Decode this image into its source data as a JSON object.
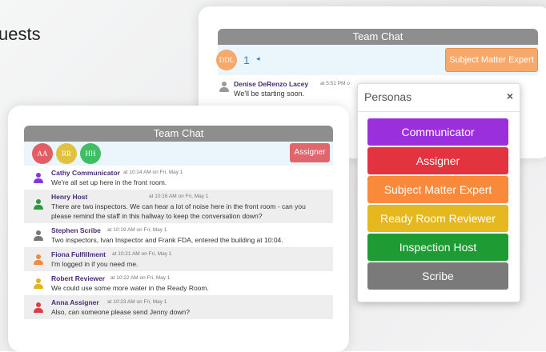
{
  "heading_fragment": "uests",
  "back_chat": {
    "title": "Team Chat",
    "avatar": "DDL",
    "count": "1",
    "arrow": "◂",
    "persona_button": "Subject Matter Expert",
    "message": {
      "name": "Denise DeRenzo Lacey",
      "time": "at 5:51 PM o",
      "text": "We'll be starting soon."
    }
  },
  "front_chat": {
    "title": "Team Chat",
    "avatars": [
      {
        "initials": "AA",
        "color": "#e35e64"
      },
      {
        "initials": "RR",
        "color": "#e0c23f"
      },
      {
        "initials": "HH",
        "color": "#3fbf63"
      }
    ],
    "persona_button": "Assigner",
    "messages": [
      {
        "name": "Cathy Communicator",
        "time": "at 10:14 AM on Fri, May 1",
        "text": "We're all set up here in the front room.",
        "icon_color": "#8a35d6"
      },
      {
        "name": "Henry Host",
        "time": "at 10:16 AM on Fri, May 1",
        "text": "There are two inspectors.  We can hear a lot of noise here in the front room - can you please remind the staff in this hallway to keep the conversation down?",
        "icon_color": "#2b9a3e"
      },
      {
        "name": "Stephen Scribe",
        "time": "at 10:19 AM on Fri, May 1",
        "text": "Two inspectors, Ivan Inspector and Frank FDA, entered the building at 10:04.",
        "icon_color": "#777777"
      },
      {
        "name": "Fiona Fulfillment",
        "time": "at 10:21 AM on Fri, May 1",
        "text": "I'm logged in if you need me.",
        "icon_color": "#f08a3c"
      },
      {
        "name": "Robert Reviewer",
        "time": "at 10:22 AM on Fri, May 1",
        "text": "We could use some more water in the Ready Room.",
        "icon_color": "#e3b320"
      },
      {
        "name": "Anna Assigner",
        "time": "at 10:23 AM on Fri, May 1",
        "text": "Also, can someone please send Jenny down?",
        "icon_color": "#e03a45"
      }
    ]
  },
  "personas_popup": {
    "title": "Personas",
    "close": "×",
    "items": [
      {
        "label": "Communicator",
        "color": "#9b2fdc"
      },
      {
        "label": "Assigner",
        "color": "#e3333f"
      },
      {
        "label": "Subject Matter Expert",
        "color": "#f98a3b"
      },
      {
        "label": "Ready Room Reviewer",
        "color": "#e4b81e"
      },
      {
        "label": "Inspection Host",
        "color": "#1e9c33"
      },
      {
        "label": "Scribe",
        "color": "#7a7a7a"
      }
    ]
  }
}
